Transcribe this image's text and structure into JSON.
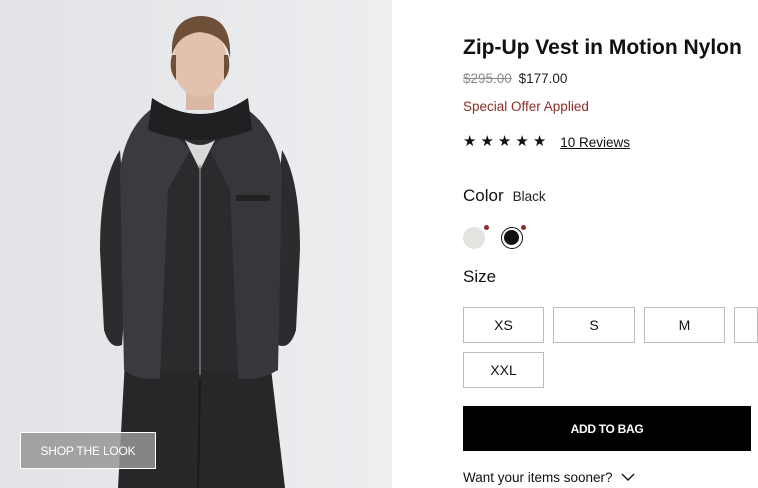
{
  "product": {
    "title": "Zip-Up Vest in Motion Nylon",
    "price_original": "$295.00",
    "price_sale": "$177.00",
    "offer_text": "Special Offer Applied",
    "rating_stars": 5,
    "reviews_link": "10 Reviews"
  },
  "image": {
    "shop_the_look_label": "SHOP THE LOOK"
  },
  "color": {
    "label": "Color",
    "selected": "Black",
    "swatches": [
      {
        "name": "ivory",
        "hex": "#e4e3df"
      },
      {
        "name": "black",
        "hex": "#111111",
        "selected": true
      }
    ],
    "accent": "#8b2f27"
  },
  "size": {
    "label": "Size",
    "options": [
      "XS",
      "S",
      "M",
      "",
      "XXL"
    ]
  },
  "actions": {
    "add_to_bag": "ADD TO BAG",
    "want_sooner": "Want your items sooner?"
  }
}
